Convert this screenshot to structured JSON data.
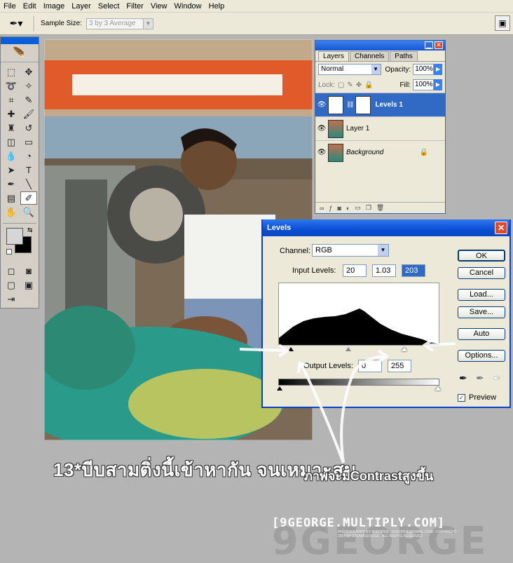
{
  "menu": [
    "File",
    "Edit",
    "Image",
    "Layer",
    "Select",
    "Filter",
    "View",
    "Window",
    "Help"
  ],
  "options": {
    "sample_size_label": "Sample Size:",
    "sample_size_value": "3 by 3 Average"
  },
  "layers_panel": {
    "tabs": [
      "Layers",
      "Channels",
      "Paths"
    ],
    "blend_mode": "Normal",
    "opacity_label": "Opacity:",
    "opacity": "100%",
    "lock_label": "Lock:",
    "fill_label": "Fill:",
    "fill": "100%",
    "layers": [
      {
        "name": "Levels 1",
        "active": true
      },
      {
        "name": "Layer 1",
        "active": false
      },
      {
        "name": "Background",
        "active": false
      }
    ]
  },
  "levels": {
    "title": "Levels",
    "channel_label": "Channel:",
    "channel": "RGB",
    "input_label": "Input Levels:",
    "input_black": "20",
    "input_gamma": "1.03",
    "input_white": "203",
    "output_label": "Output Levels:",
    "output_black": "0",
    "output_white": "255",
    "buttons": [
      "OK",
      "Cancel",
      "Load...",
      "Save...",
      "Auto",
      "Options..."
    ],
    "preview_label": "Preview",
    "preview_checked": true
  },
  "annotation": {
    "main": "13*บีบสามติ่งนี้เข้าหากัน จนเหมาะสม",
    "sub": "ภาพจะมีContrastสูงขึ้น"
  },
  "watermark": {
    "url": "[9GEORGE.MULTIPLY.COM]",
    "big": "9GEORGE",
    "small": "PHOTOGRAPHY BY 9GEORGE · 9GEORGE@GMAIL.COM · COPYRIGHT 2007 BY 9TEAMGEORGE · ALL RIGHTS RESERVED"
  },
  "colors": {
    "titlebar": "#0a4fd4",
    "dialog_bg": "#ece9d8",
    "layer_active": "#316ac5"
  }
}
